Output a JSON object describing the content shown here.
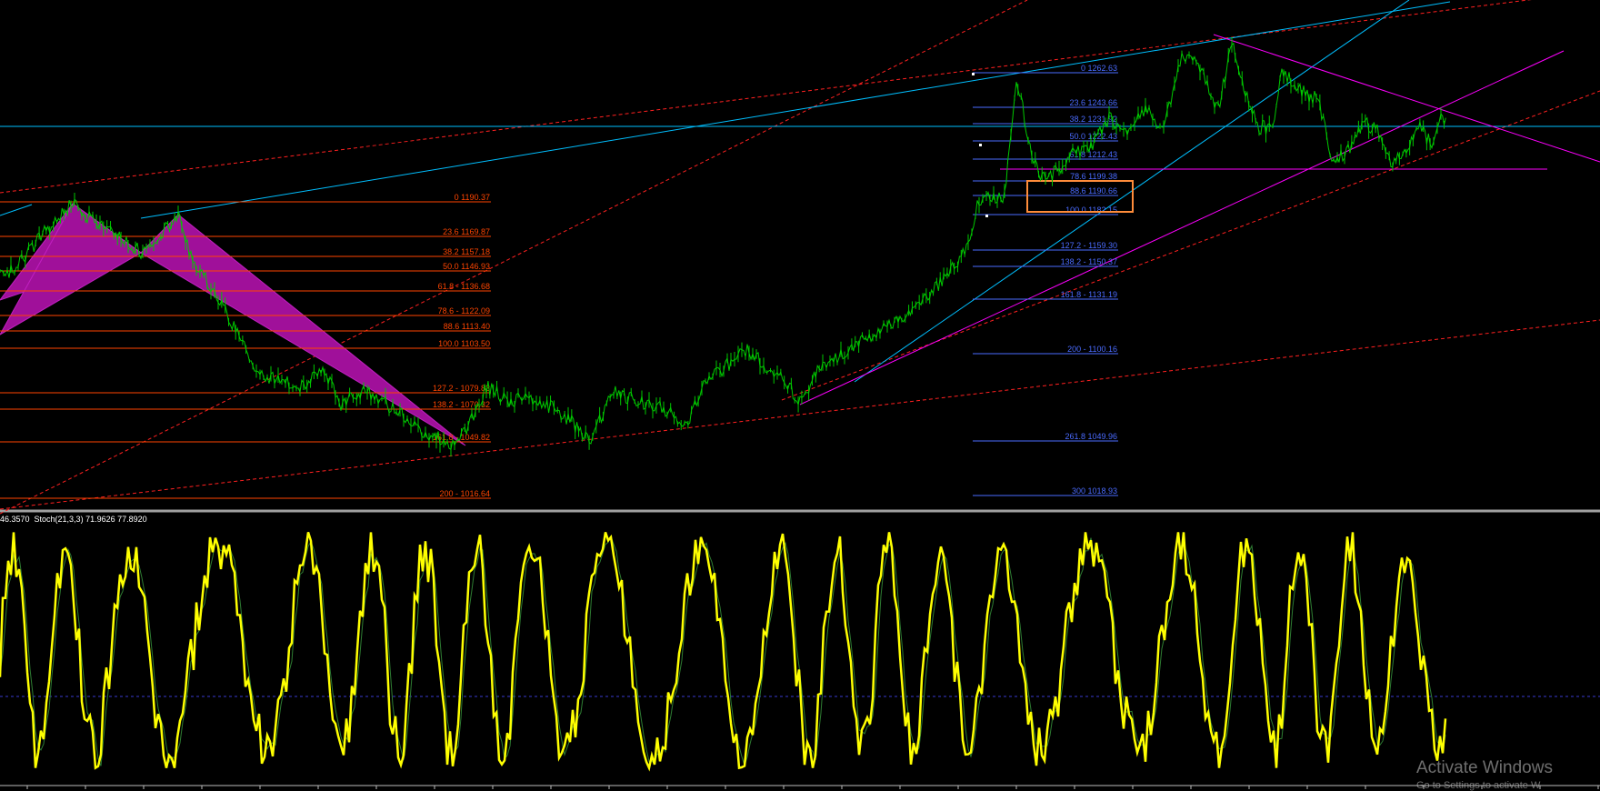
{
  "indicator_label": "46.3570  Stoch(21,3,3) 71.9626 77.8920",
  "watermark": {
    "title": "Activate Windows",
    "subtitle": "Go to Settings to activate W"
  },
  "colors": {
    "background": "#000000",
    "candles": "#00c800",
    "fib_left": "#ff4500",
    "fib_right": "#4a6bff",
    "trendline_cyan": "#00bfff",
    "trendline_magenta": "#ff00ff",
    "channel_red": "#ff2020",
    "pattern_fill": "#a0109a",
    "stoch_main": "#ffff00",
    "stoch_signal": "#2e7d32",
    "highlight_box": "#ff8c3a"
  },
  "fib_left_levels": [
    "0 1190.37",
    "23.6 1169.87",
    "38.2 1157.18",
    "50.0 1146.93",
    "61.8 - 1136.68",
    "78.6 - 1122.09",
    "88.6 1113.40",
    "100.0 1103.50",
    "127.2 - 1079.83",
    "138.2 - 1070.32",
    "161.8 - 1049.82",
    "200 - 1016.64"
  ],
  "fib_right_levels": [
    "0 1262.63",
    "23.6 1243.66",
    "38.2 1231.92",
    "50.0 1222.43",
    "61.8 1212.43",
    "78.6 1199.38",
    "88.6 1190.66",
    "100.0 1182.15",
    "127.2 - 1159.30",
    "138.2 - 1150.37",
    "161.8 - 1131.19",
    "200 - 1100.16",
    "261.8 1049.96",
    "300 1018.93"
  ]
}
